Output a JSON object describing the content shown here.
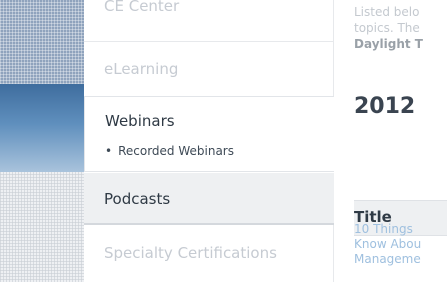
{
  "sidebar": {
    "items": [
      {
        "label": "CE Center"
      },
      {
        "label": "eLearning"
      },
      {
        "label": "Webinars",
        "sub": [
          {
            "label": "Recorded Webinars"
          }
        ]
      },
      {
        "label": "Podcasts"
      },
      {
        "label": "Specialty Certifications"
      }
    ]
  },
  "main": {
    "intro_lines": [
      "Listed belo",
      "topics. The",
      "Daylight T"
    ],
    "year": "2012",
    "table": {
      "header": "Title",
      "link_lines": [
        "10 Things",
        "Know Abou",
        "Manageme"
      ]
    }
  },
  "colors": {
    "accent_link": "#9fc0df",
    "active_text": "#2f3a45",
    "dim_text": "#c6cbd2"
  },
  "icons": [
    "bullet-dot"
  ]
}
